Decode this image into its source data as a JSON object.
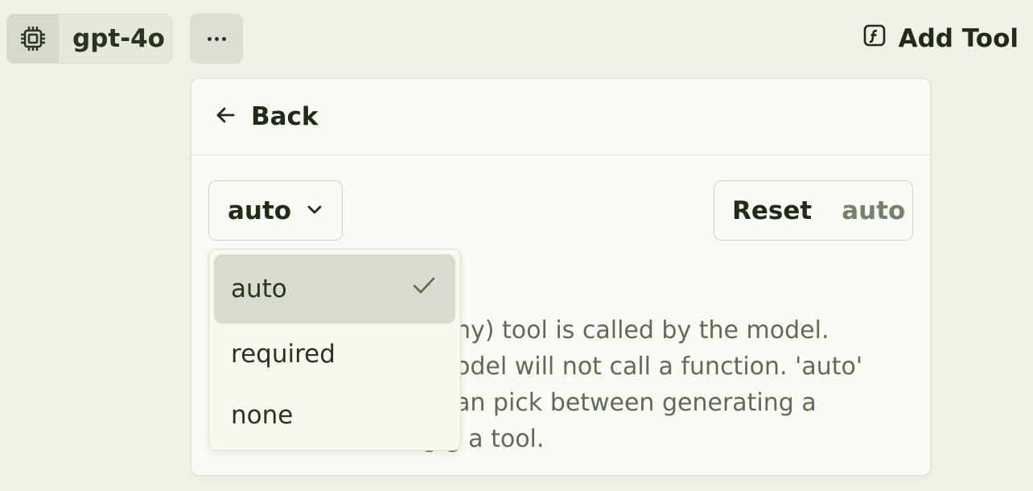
{
  "top_bar": {
    "model_name": "gpt-4o",
    "add_tool_label": "Add Tool"
  },
  "panel": {
    "back_label": "Back",
    "tool_choice": {
      "selected": "auto",
      "options": [
        {
          "label": "auto",
          "selected": true
        },
        {
          "label": "required",
          "selected": false
        },
        {
          "label": "none",
          "selected": false
        }
      ]
    },
    "reset": {
      "label": "Reset",
      "value": "auto"
    },
    "description_lines": [
      "ny) tool is called by the model.",
      "odel will not call a function. 'auto'",
      "an pick between generating a",
      "g      g a tool."
    ]
  },
  "colors": {
    "background": "#f0f0e6",
    "panel": "#fbfbf5",
    "text_dark": "#1f2d17",
    "text_muted": "#75826a",
    "selected_option_bg": "#d8dbd0"
  },
  "icons": {
    "model": "cpu-chip-icon",
    "more": "ellipsis-icon",
    "add_tool": "function-square-icon",
    "back": "arrow-left-icon",
    "select": "chevron-down-icon",
    "selected_option": "check-icon"
  }
}
